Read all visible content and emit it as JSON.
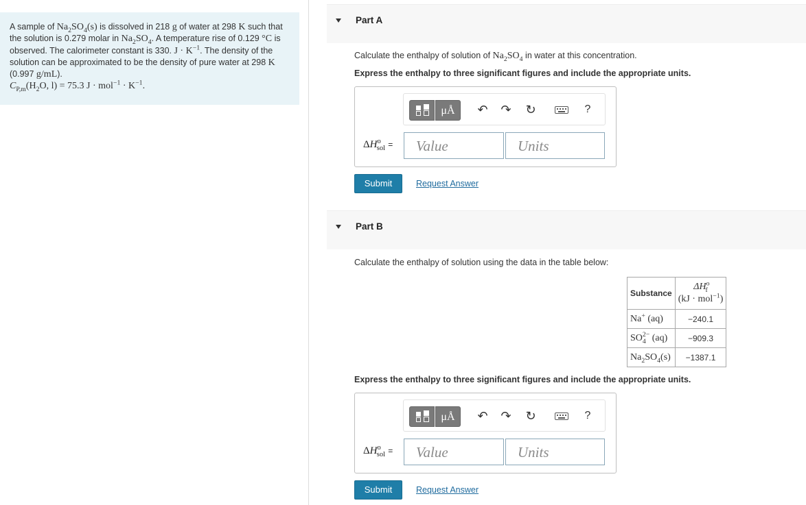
{
  "problem": {
    "t1": "A sample of ",
    "salt_formula": "Na2SO4(s)",
    "t2": " is dissolved in 218 ",
    "g": "g",
    "t3": " of water at 298 ",
    "K": "K",
    "t4": " such that the solution is 0.279 molar in ",
    "formula2": "Na2SO4",
    "t5": ". A temperature rise of 0.129 ",
    "degC": "°C",
    "t6": " is observed. The calorimeter constant is 330. ",
    "calunit": "J · K",
    "t7": ". The density of the solution can be approximated to be the density of pure water at 298 ",
    "t8": " (0.997 ",
    "gml": "g/mL",
    "t9": ").",
    "cp_label": "CP,m(H2O, l) = 75.3 J · mol",
    "cp_unit_k": " · K"
  },
  "part_a": {
    "header": "Part A",
    "instruction_pre": "Calculate the enthalpy of solution of ",
    "instruction_formula": "Na2SO4",
    "instruction_post": " in water at this concentration.",
    "express": "Express the enthalpy to three significant figures and include the appropriate units.",
    "value_placeholder": "Value",
    "units_placeholder": "Units",
    "submit": "Submit",
    "request": "Request Answer"
  },
  "part_b": {
    "header": "Part B",
    "instruction": "Calculate the enthalpy of solution using the data in the table below:",
    "express": "Express the enthalpy to three significant figures and include the appropriate units.",
    "value_placeholder": "Value",
    "units_placeholder": "Units",
    "submit": "Submit",
    "request": "Request Answer",
    "table": {
      "col1": "Substance",
      "col2_unit": "(kJ · mol",
      "rows": [
        {
          "substance": "Na+ (aq)",
          "value": "−240.1"
        },
        {
          "substance": "SO42− (aq)",
          "value": "−909.3"
        },
        {
          "substance": "Na2SO4(s)",
          "value": "−1387.1"
        }
      ]
    }
  },
  "toolbar": {
    "units_btn": "μÅ",
    "help": "?",
    "icons": [
      "fraction-template-icon",
      "units-icon",
      "undo-icon",
      "redo-icon",
      "reset-icon",
      "keyboard-icon",
      "help-icon"
    ]
  },
  "answer_label": "ΔH°sol ="
}
